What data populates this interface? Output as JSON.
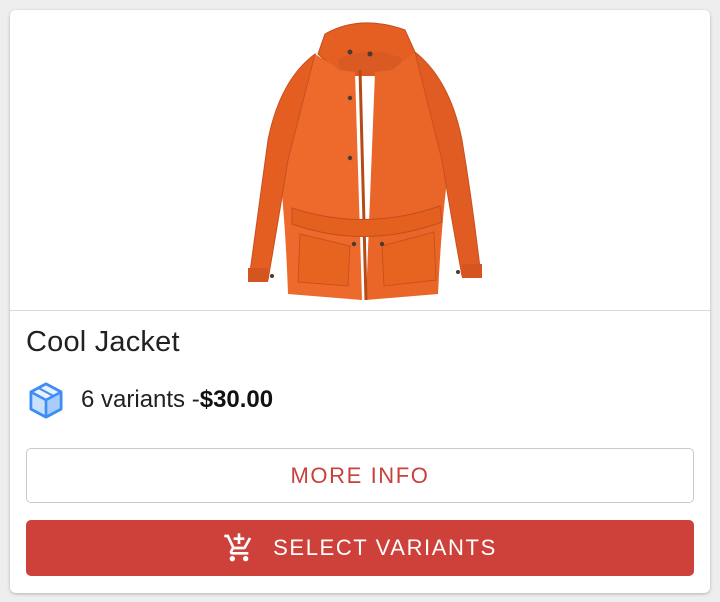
{
  "product": {
    "image_alt": "orange jacket",
    "title": "Cool Jacket",
    "variants_text": "6 variants - ",
    "price": "$30.00",
    "variants_icon": "box-icon"
  },
  "actions": {
    "more_info_label": "MORE INFO",
    "select_variants_label": "SELECT VARIANTS",
    "select_variants_icon": "add-shopping-cart-icon"
  },
  "colors": {
    "accent": "#cd413a",
    "icon_blue": "#3d8df5",
    "jacket_orange": "#ee6a2c"
  }
}
